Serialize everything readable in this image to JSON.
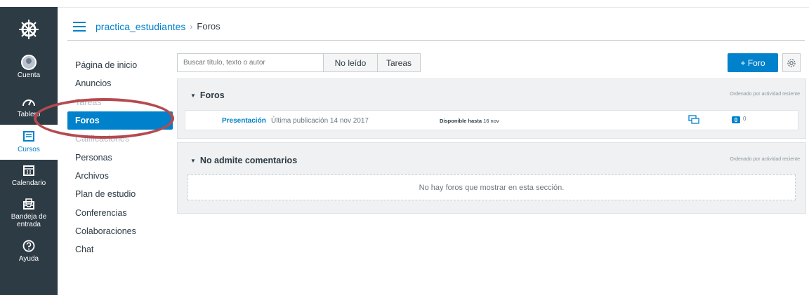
{
  "global_nav": {
    "items": [
      {
        "label": "Cuenta",
        "icon": "avatar"
      },
      {
        "label": "Tablero",
        "icon": "dashboard-icon"
      },
      {
        "label": "Cursos",
        "icon": "courses-icon"
      },
      {
        "label": "Calendario",
        "icon": "calendar-icon"
      },
      {
        "label": "Bandeja de entrada",
        "icon": "inbox-icon"
      },
      {
        "label": "Ayuda",
        "icon": "help-icon"
      }
    ]
  },
  "breadcrumb": {
    "course": "practica_estudiantes",
    "separator": "›",
    "current": "Foros"
  },
  "course_nav": {
    "items": [
      {
        "label": "Página de inicio"
      },
      {
        "label": "Anuncios"
      },
      {
        "label": "Tareas"
      },
      {
        "label": "Foros"
      },
      {
        "label": "Calificaciones"
      },
      {
        "label": "Personas"
      },
      {
        "label": "Archivos"
      },
      {
        "label": "Plan de estudio"
      },
      {
        "label": "Conferencias"
      },
      {
        "label": "Colaboraciones"
      },
      {
        "label": "Chat"
      }
    ]
  },
  "toolbar": {
    "search_placeholder": "Buscar título, texto o autor",
    "unread_label": "No leído",
    "assignments_label": "Tareas",
    "add_label": "+ Foro"
  },
  "sections": [
    {
      "title": "Foros",
      "sort_label": "Ordenado por actividad reciente",
      "topics": [
        {
          "title": "Presentación",
          "last_post": "Última publicación 14 nov 2017",
          "available_label": "Disponible hasta",
          "available_date": "16 nov",
          "unread": "0",
          "replies": "0"
        }
      ]
    },
    {
      "title": "No admite comentarios",
      "sort_label": "Ordenado por actividad reciente",
      "empty_message": "No hay foros que mostrar en esta sección."
    }
  ],
  "colors": {
    "nav_bg": "#2d3b45",
    "brand": "#0081cb",
    "highlight_circle": "#b44a4f"
  }
}
